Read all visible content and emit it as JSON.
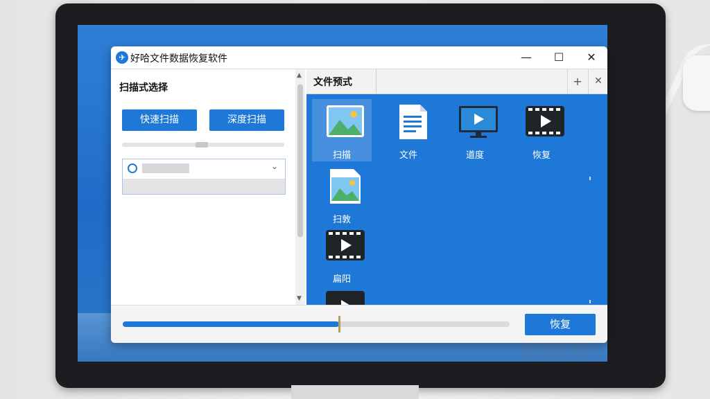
{
  "window": {
    "title": "好哈文件数据恢复软件",
    "controls": {
      "minimize": "—",
      "maximize": "☐",
      "close": "✕"
    }
  },
  "left_panel": {
    "section_title": "扫描式选择",
    "quick_scan_label": "快速扫描",
    "deep_scan_label": "深度扫描",
    "drive_select": {
      "selected": "",
      "chevron": "⌄"
    }
  },
  "right_panel": {
    "tab_label": "文件预式",
    "tab_add": "+",
    "tab_close": "✕",
    "files": [
      {
        "label": "扫描",
        "icon": "image-file-icon",
        "selected": true
      },
      {
        "label": "文件",
        "icon": "document-file-icon",
        "selected": false
      },
      {
        "label": "道度",
        "icon": "video-monitor-icon",
        "selected": false
      },
      {
        "label": "恢复",
        "icon": "video-file-icon",
        "selected": false
      },
      {
        "label": "扫敦",
        "icon": "image-file-icon",
        "selected": false
      },
      {
        "label": "扁阳",
        "icon": "video-file-icon",
        "selected": false
      }
    ]
  },
  "bottom_bar": {
    "progress_fraction": 0.56,
    "restore_label": "恢复"
  },
  "colors": {
    "accent": "#1e78d8",
    "screen_bg": "#2573d0",
    "monitor_bezel": "#1c1d20"
  }
}
